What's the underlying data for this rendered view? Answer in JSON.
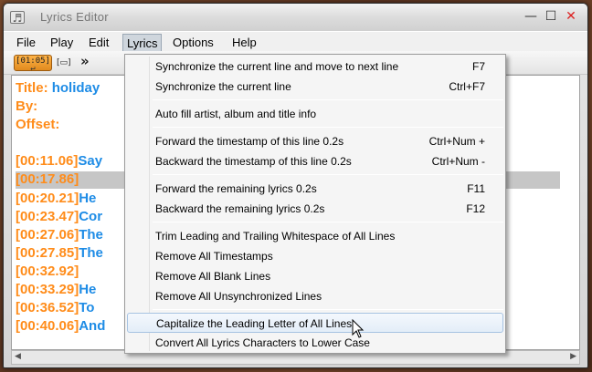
{
  "window": {
    "title": "Lyrics Editor",
    "app_icon": "♬",
    "min_glyph": "—",
    "max_glyph": "☐",
    "close_glyph": "✕"
  },
  "menubar": {
    "items": [
      "File",
      "Play",
      "Edit",
      "Lyrics",
      "Options",
      "Help"
    ],
    "active": "Lyrics"
  },
  "toolbar": {
    "time": "[01:05]",
    "time_arrow": "↵",
    "stamp_glyph": "[▭]",
    "forward_glyph": "»"
  },
  "editor": {
    "title_label": "Title:",
    "title_value": "holiday",
    "by_label": "By:",
    "offset_label": "Offset:",
    "lines": [
      {
        "ts": "[00:11.06]",
        "text": "Say"
      },
      {
        "ts": "[00:17.86]",
        "text": ""
      },
      {
        "ts": "[00:20.21]",
        "text": "He"
      },
      {
        "ts": "[00:23.47]",
        "text": "Cor"
      },
      {
        "ts": "[00:27.06]",
        "text": "The"
      },
      {
        "ts": "[00:27.85]",
        "text": "The"
      },
      {
        "ts": "[00:32.92]",
        "text": ""
      },
      {
        "ts": "[00:33.29]",
        "text": "He"
      },
      {
        "ts": "[00:36.52]",
        "text": "To"
      },
      {
        "ts": "[00:40.06]",
        "text": "And"
      }
    ],
    "selected_index": 1
  },
  "scrollbar": {
    "left_arrow": "◀",
    "right_arrow": "▶"
  },
  "lyrics_menu": {
    "items": [
      {
        "label": "Synchronize the current line and move to next line",
        "shortcut": "F7"
      },
      {
        "label": "Synchronize the current line",
        "shortcut": "Ctrl+F7"
      },
      {
        "label": "Auto fill artist, album and title info",
        "shortcut": ""
      },
      {
        "label": "Forward the timestamp of this line 0.2s",
        "shortcut": "Ctrl+Num +"
      },
      {
        "label": "Backward the timestamp of this line 0.2s",
        "shortcut": "Ctrl+Num -"
      },
      {
        "label": "Forward the remaining lyrics 0.2s",
        "shortcut": "F11"
      },
      {
        "label": "Backward the remaining lyrics 0.2s",
        "shortcut": "F12"
      },
      {
        "label": "Trim Leading and Trailing Whitespace of All Lines",
        "shortcut": ""
      },
      {
        "label": "Remove All Timestamps",
        "shortcut": ""
      },
      {
        "label": "Remove All Blank Lines",
        "shortcut": ""
      },
      {
        "label": "Remove All Unsynchronized Lines",
        "shortcut": ""
      },
      {
        "label": "Capitalize the Leading Letter of All Lines",
        "shortcut": ""
      },
      {
        "label": "Convert All Lyrics Characters to Lower Case",
        "shortcut": ""
      }
    ],
    "hovered_index": 11
  },
  "colors": {
    "timestamp": "#ff8c1a",
    "lyric_text": "#1e8ce6",
    "selection": "#c6c6c6"
  }
}
